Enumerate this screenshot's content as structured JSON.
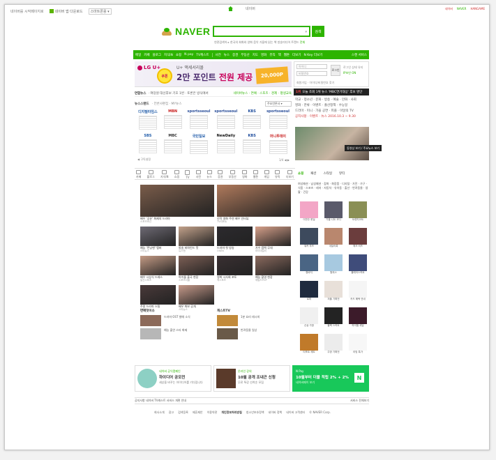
{
  "topbar": {
    "chip1": "네이버를 시작페이지로",
    "chip2": "네이버 앱 다운로드",
    "chip3": "스마트폰용 ▾",
    "mid_label": "네이버",
    "right_1": "네이버",
    "right_2": "NAVER",
    "right_3": "HANGAME"
  },
  "header": {
    "logo": "NAVER",
    "search_placeholder": "",
    "search_arrow": "▾",
    "search_button": "검색",
    "sub_prefix": "연관검색어 ▸",
    "sub_text": " 한국의 회화와 양화 음악   가을에 읽는 책   방송미디어 트렌드",
    "sub_green": " 전체"
  },
  "gnb": {
    "items": [
      "메일",
      "카페",
      "블로그",
      "지식iN",
      "쇼핑",
      "N pay",
      "TV캐스트",
      "사전",
      "뉴스",
      "증권",
      "부동산",
      "지도",
      "영화",
      "뮤직",
      "책",
      "웹툰"
    ],
    "more": "더보기",
    "key_label": "N Key 더보기",
    "right": "스캔 서비스"
  },
  "ad": {
    "brand": "LG U+",
    "badge": "쿠폰",
    "title": "U+ 액세서리몰",
    "main_prefix": "2만 포인트 ",
    "main_strong": "전원 제공",
    "coupon": "20,000P"
  },
  "login": {
    "id_placeholder": "아이디",
    "pw_placeholder": "비밀번호",
    "button": "로그인",
    "check": "로그인 상태 유지",
    "check2": "IP보안 ON",
    "links": "회원가입 · 아이디/비밀번호 찾기"
  },
  "newsbar": {
    "label": "연합뉴스",
    "text": "· 여당원 대선후보 기호 1번 · 토론은 방식에서",
    "right": "네이버뉴스 · 연예 · 스포츠 · 경제 · 평생교육"
  },
  "newsstand": {
    "title": "뉴스스탠드",
    "sub": "· 언론사편집 · MY뉴스",
    "select": "주요언론사 ▾"
  },
  "press": [
    "디지털타임스",
    "MBN",
    "sportsseoul",
    "sportsseoul",
    "KBS",
    "sportsseoul",
    "SBS",
    "MBC",
    "국민일보",
    "NewDaily",
    "KBS",
    "머니투데이"
  ],
  "press_foot": {
    "left": "◀ 구독설정",
    "right": "1/4 ◀ ▶"
  },
  "issue": {
    "head_red": "1위",
    "head": " 오늘 조회 1위 뉴스 'MBC연기대상' 후보 명단",
    "lines": [
      "학교 · 청소년 · 문화 · 방송 · 예술 · 만화 · 사회",
      "영화 · 한류 · 이벤트 · 출산정책 · 수능일",
      "드라마 · 미니 · 가을 공연 · 피플 · 이달의 TV",
      "공지사항 · 이벤트 · 뉴스 2016.10.3 ~ 9.30"
    ],
    "tooltip": "동영상 보기 / 주요뉴스 보기"
  },
  "services": [
    "카페",
    "블로그",
    "지식iN",
    "쇼핑",
    "TV",
    "사전",
    "뉴스",
    "증권",
    "부동산",
    "영화",
    "웹툰",
    "게임",
    "뮤직",
    "더보기"
  ],
  "shopping": {
    "tabs": [
      "쇼핑",
      "패션",
      "스타일",
      "뷰티"
    ],
    "cats": "여성패션 · 남성패션 · 잡화 · 화장품 · 디지털 · 가전 · 가구 · 식품 · 스포츠 · 레저 · 자동차 · 유아동 · 출산 · 반려동물 · 생활 · 건강",
    "items": [
      {
        "caption": "이번주 핫딜",
        "color": "#f3a6c6"
      },
      {
        "caption": "가을 니트 코디",
        "color": "#5a5a6a"
      },
      {
        "caption": "트렌치코트",
        "color": "#8a8f55"
      },
      {
        "caption": "워커 부츠",
        "color": "#3d4a5d"
      },
      {
        "caption": "데일리룩",
        "color": "#b9876e"
      },
      {
        "caption": "체크 셔츠",
        "color": "#6b3d3d"
      },
      {
        "caption": "청바지",
        "color": "#4a6584"
      },
      {
        "caption": "원피스",
        "color": "#a7c9e0"
      },
      {
        "caption": "플레어스커트",
        "color": "#3f4c7a"
      },
      {
        "caption": "로퍼",
        "color": "#1f2b3f"
      },
      {
        "caption": "겨울 기획전",
        "color": "#e8e0d9"
      },
      {
        "caption": "카드 혜택 안내",
        "color": "#f5f5f5"
      },
      {
        "caption": "신상 가방",
        "color": "#f0f0f0"
      },
      {
        "caption": "블랙 스커트",
        "color": "#232323"
      },
      {
        "caption": "하이힐 세일",
        "color": "#3c1b2a"
      },
      {
        "caption": "티포트 세트",
        "color": "#c07a2a"
      },
      {
        "caption": "주방 기획전",
        "color": "#ececec"
      },
      {
        "caption": "리빙 특가",
        "color": "#f7f7f7"
      }
    ]
  },
  "photos": [
    {
      "caption": "배우 '공유' 화제의 드라마",
      "src": "스포츠조선",
      "color": "#7a5c4a",
      "big": true
    },
    {
      "caption": "신작 영화 주연 배우 인터뷰",
      "src": "TV리포트",
      "color": "#b07a5c",
      "big": true
    },
    {
      "caption": "예능 '런닝맨' 멤버",
      "src": "스타뉴스",
      "color": "#6e6a74"
    },
    {
      "caption": "방송 비하인드 컷",
      "src": "뉴스엔",
      "color": "#c3a28b"
    },
    {
      "caption": "드라마 첫 방송",
      "src": "OSEN",
      "color": "#2c2a2e"
    },
    {
      "caption": "가수 컴백 무대",
      "src": "마이데일리",
      "color": "#d6a08a"
    },
    {
      "caption": "배우 시상식 드레스",
      "src": "일간스포츠",
      "color": "#c49b85"
    },
    {
      "caption": "아이돌 출국 현장",
      "src": "스포츠서울",
      "color": "#7d5f55"
    },
    {
      "caption": "영화 시사회 포토",
      "src": "엑스포츠",
      "color": "#3a3032"
    },
    {
      "caption": "예능 촬영 현장",
      "src": "헤럴드POP",
      "color": "#8b6a5e"
    },
    {
      "caption": "주말 드라마 스틸",
      "src": "MBN",
      "color": "#4a3a3a"
    },
    {
      "caption": "배우 화보 공개",
      "src": "스타뉴스",
      "color": "#c69a8a"
    }
  ],
  "subblocks": {
    "left_title": "연예핫이슈",
    "left_items": [
      {
        "tx": "드라마 OST 발매 소식",
        "color": "#8c6a5a"
      },
      {
        "tx": "예능 출연 스타 화제",
        "color": "#b7b7b7"
      }
    ],
    "right_title": "캐스트TV",
    "right_items": [
      {
        "tx": "1분 요리 레시피",
        "color": "#c28a3a"
      },
      {
        "tx": "반려동물 일상",
        "color": "#6a5a48"
      }
    ]
  },
  "bottom": {
    "ads": [
      {
        "t1": "네이버 공익캠페인",
        "t2": "하이디어 공모전",
        "t3": "세상을 바꾸는 아이디어를 기다립니다"
      },
      {
        "t1": "온라인 강의",
        "t2": "10월 공개 조내곤 신청",
        "t3": "무료 특강 선착순 모집"
      },
      {
        "t1": "N Pay",
        "t2": "10월부터 더블 적립 2% + 2%",
        "t3": "네이버페이 보기"
      }
    ],
    "n_logo": "N"
  },
  "footer": {
    "left": "공지사항  네이버 TV캐스트 서비스 개편 안내",
    "right": "서비스 전체보기",
    "links": [
      "회사소개",
      "광고",
      "검색등록",
      "제휴제안",
      "이용약관",
      "개인정보처리방침",
      "청소년보호정책",
      "네이버 정책",
      "네이버 고객센터",
      "© NAVER Corp."
    ]
  },
  "colors": {
    "brand": "#2db400",
    "accent": "#c8005a"
  }
}
